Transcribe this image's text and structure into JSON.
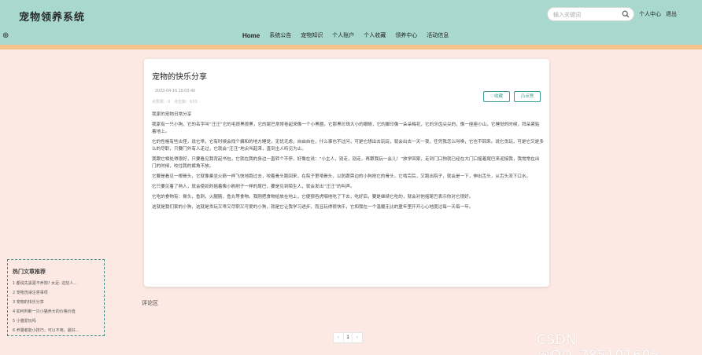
{
  "header": {
    "site_title": "宠物领养系统",
    "side_glyph": "⊕",
    "search_placeholder": "输入关键词",
    "user_center": "个人中心",
    "logout": "退出"
  },
  "nav": {
    "items": [
      "Home",
      "系统公告",
      "宠物知识",
      "个人账户",
      "个人收藏",
      "领养中心",
      "活动信息"
    ],
    "active_index": 0
  },
  "post": {
    "title": "宠物的快乐分享",
    "date": "2023-04-16 15:03:40",
    "stats": "点赞数：0　点击数：633",
    "collect_label": "♡收藏",
    "like_label": "凸点赞",
    "paragraphs": [
      "我家的宠物日常分享",
      "我家有一只小狗，它的名字叫“汪汪”它的毛很黑很黑，它的尾巴常常卷起来像一个小黑圈，它那黑珍珠大小的眼睛，它的脚印像一朵朵梅花，它的牙齿尖尖的，像一座座小山，它睡觉的时候，拜朵紧贴着地上。",
      "它的性格有些古怪，说它乖，它有时候会找个偏和的地方睡觉，无忧无虑，自由自在，什么事也不过问，可是它想出去玩玩，就会出去一天一夜，任凭我怎么叫唤，它也不回来。说它贪玩，可是它又是多么的尽职，只要门外有人走过，它就会“汪汪”地尖叫起来，直到主人听见为止。",
      "我跟它相处得很好，只要看见我背起书包，它就在我的身边一直转个不停，好像在说：“小主人，别走，别走，再跟我玩一会儿！”放学回家，走到门口狗就已经在大门口摇着尾巴来迎接我，我常常在出门的时候，咬住我的裤角不放。",
      "它要是看见一根骨头，它就像乘坐火箭一样飞快地跑过去，咬着骨头跑回来，在院子里啃骨头，以防跟旁边的小狗抢它的骨头，它啃完后，又跑出院子，就会是一下，伸出舌头，从舌头流下口水。",
      "它只要见着了熟人，就会使劲的摇着像小刷刷子一样的尾巴，要是见到陌生人，就会发出“汪汪”的叫声。",
      "它吃的食物有：骨头，鱼刺，火腿肠，鱼丸等食物。我刚把食物给放在地上，它便狼吞虎咽地吃了下去，吃好后，要是继续它吃的，就会对他摇尾巴表示你对它很好。",
      "这就是我们家的小狗，这就是贪玩又乖又尽职又可爱的小狗，就是它让我学习进步，而且玩得很快乐，它和我在一个温暖无比的童年里开开心心地度过每一天每一年。"
    ]
  },
  "hot_articles": {
    "title": "热门文章推荐",
    "items": [
      "1 都说先黑驱不养狗? 女足: 这些人...",
      "2 宠物洗澡注意事项",
      "3 宠物的快乐分享",
      "4 如何判断一只小猫养大的价格价值",
      "5 小猫爱玩吗",
      "6 养猫者能小技巧，可以不用。最好..."
    ]
  },
  "comments": {
    "label": "评论区"
  },
  "pager": {
    "prev": "‹",
    "current": "1",
    "next": "›"
  },
  "watermark": "CSDN @QQ_785101605",
  "colors": {
    "header_bg": "#a9d9ce",
    "page_bg": "#fde9e3",
    "accent": "#3a9a8e",
    "strip": "#f6c48a"
  }
}
